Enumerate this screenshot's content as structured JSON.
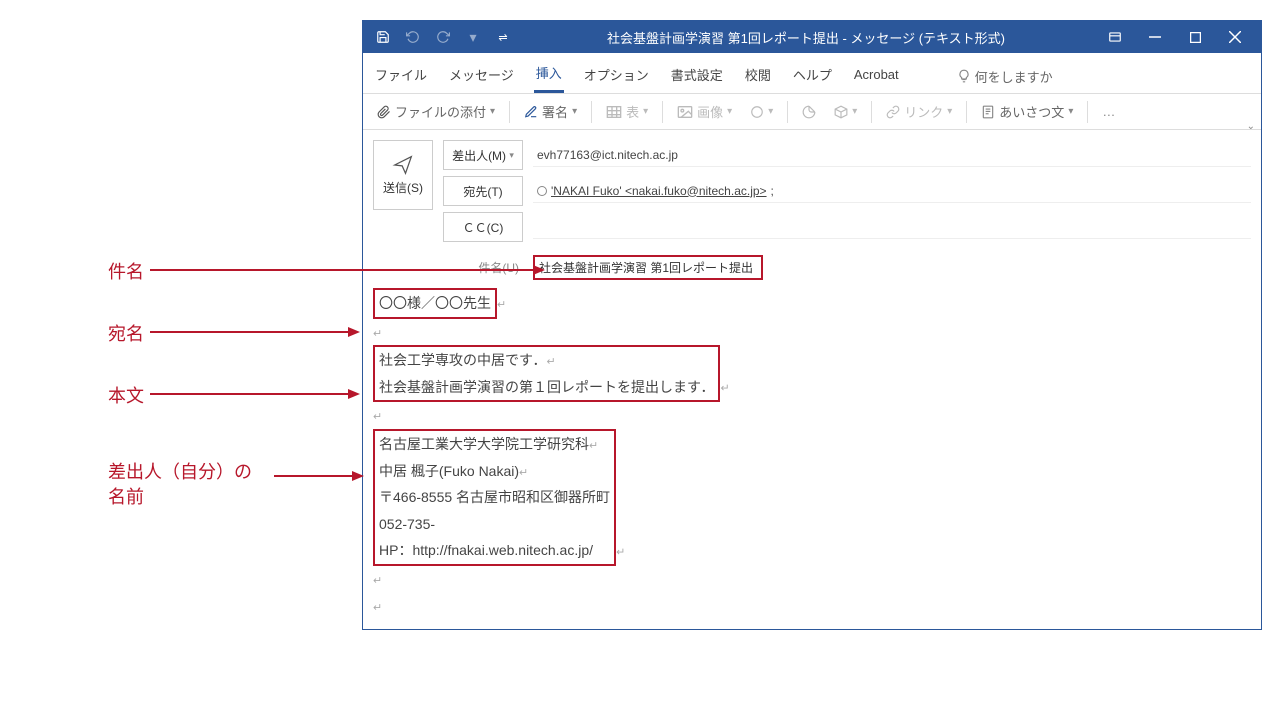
{
  "window": {
    "title": "社会基盤計画学演習  第1回レポート提出  -  メッセージ (テキスト形式)"
  },
  "ribbon": {
    "tabs": {
      "file": "ファイル",
      "message": "メッセージ",
      "insert": "挿入",
      "options": "オプション",
      "format": "書式設定",
      "review": "校閲",
      "help": "ヘルプ",
      "acrobat": "Acrobat"
    },
    "tell_me": "何をしますか",
    "toolbar": {
      "attach": "ファイルの添付",
      "signature": "署名",
      "table": "表",
      "image": "画像",
      "link": "リンク",
      "greeting": "あいさつ文"
    }
  },
  "compose": {
    "send": "送信(S)",
    "from_btn": "差出人(M)",
    "from_value": "evh77163@ict.nitech.ac.jp",
    "to_btn": "宛先(T)",
    "to_value": "'NAKAI Fuko' <nakai.fuko@nitech.ac.jp>",
    "cc_btn": "ＣＣ(C)",
    "subject_label": "件名(U)",
    "subject_value": "社会基盤計画学演習  第1回レポート提出"
  },
  "body": {
    "salutation": "〇〇様／〇〇先生",
    "main_line1": "社会工学専攻の中居です．",
    "main_line2": "社会基盤計画学演習の第１回レポートを提出します．",
    "sig1": "名古屋工業大学大学院工学研究科",
    "sig2": "中居  楓子(Fuko Nakai)",
    "sig3": "〒466-8555  名古屋市昭和区御器所町",
    "sig4": "052-735-",
    "sig5": "HP：http://fnakai.web.nitech.ac.jp/"
  },
  "annot": {
    "subject": "件名",
    "salutation": "宛名",
    "body": "本文",
    "sender": "差出人（自分）の名前"
  }
}
